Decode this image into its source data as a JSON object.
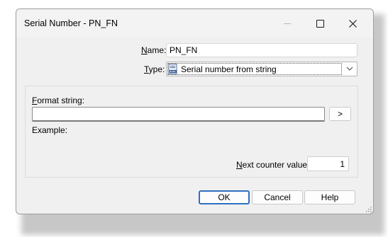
{
  "window": {
    "title": "Serial Number - PN_FN"
  },
  "form": {
    "name_label_accel": "N",
    "name_label_rest": "ame:",
    "name_value": "PN_FN",
    "type_label_accel": "T",
    "type_label_rest": "ype:",
    "type_value": "Serial number from string",
    "type_icon": "serial-number-icon",
    "format_label_accel": "F",
    "format_label_rest": "ormat string:",
    "format_value": "",
    "insert_button_label": ">",
    "example_label": "Example:",
    "counter_label_accel": "N",
    "counter_label_rest": "ext counter value:",
    "counter_value": "1"
  },
  "buttons": {
    "ok": "OK",
    "cancel": "Cancel",
    "help": "Help"
  },
  "colors": {
    "dialog_bg": "#f0f0f0",
    "default_button_border": "#2f6fc0"
  }
}
